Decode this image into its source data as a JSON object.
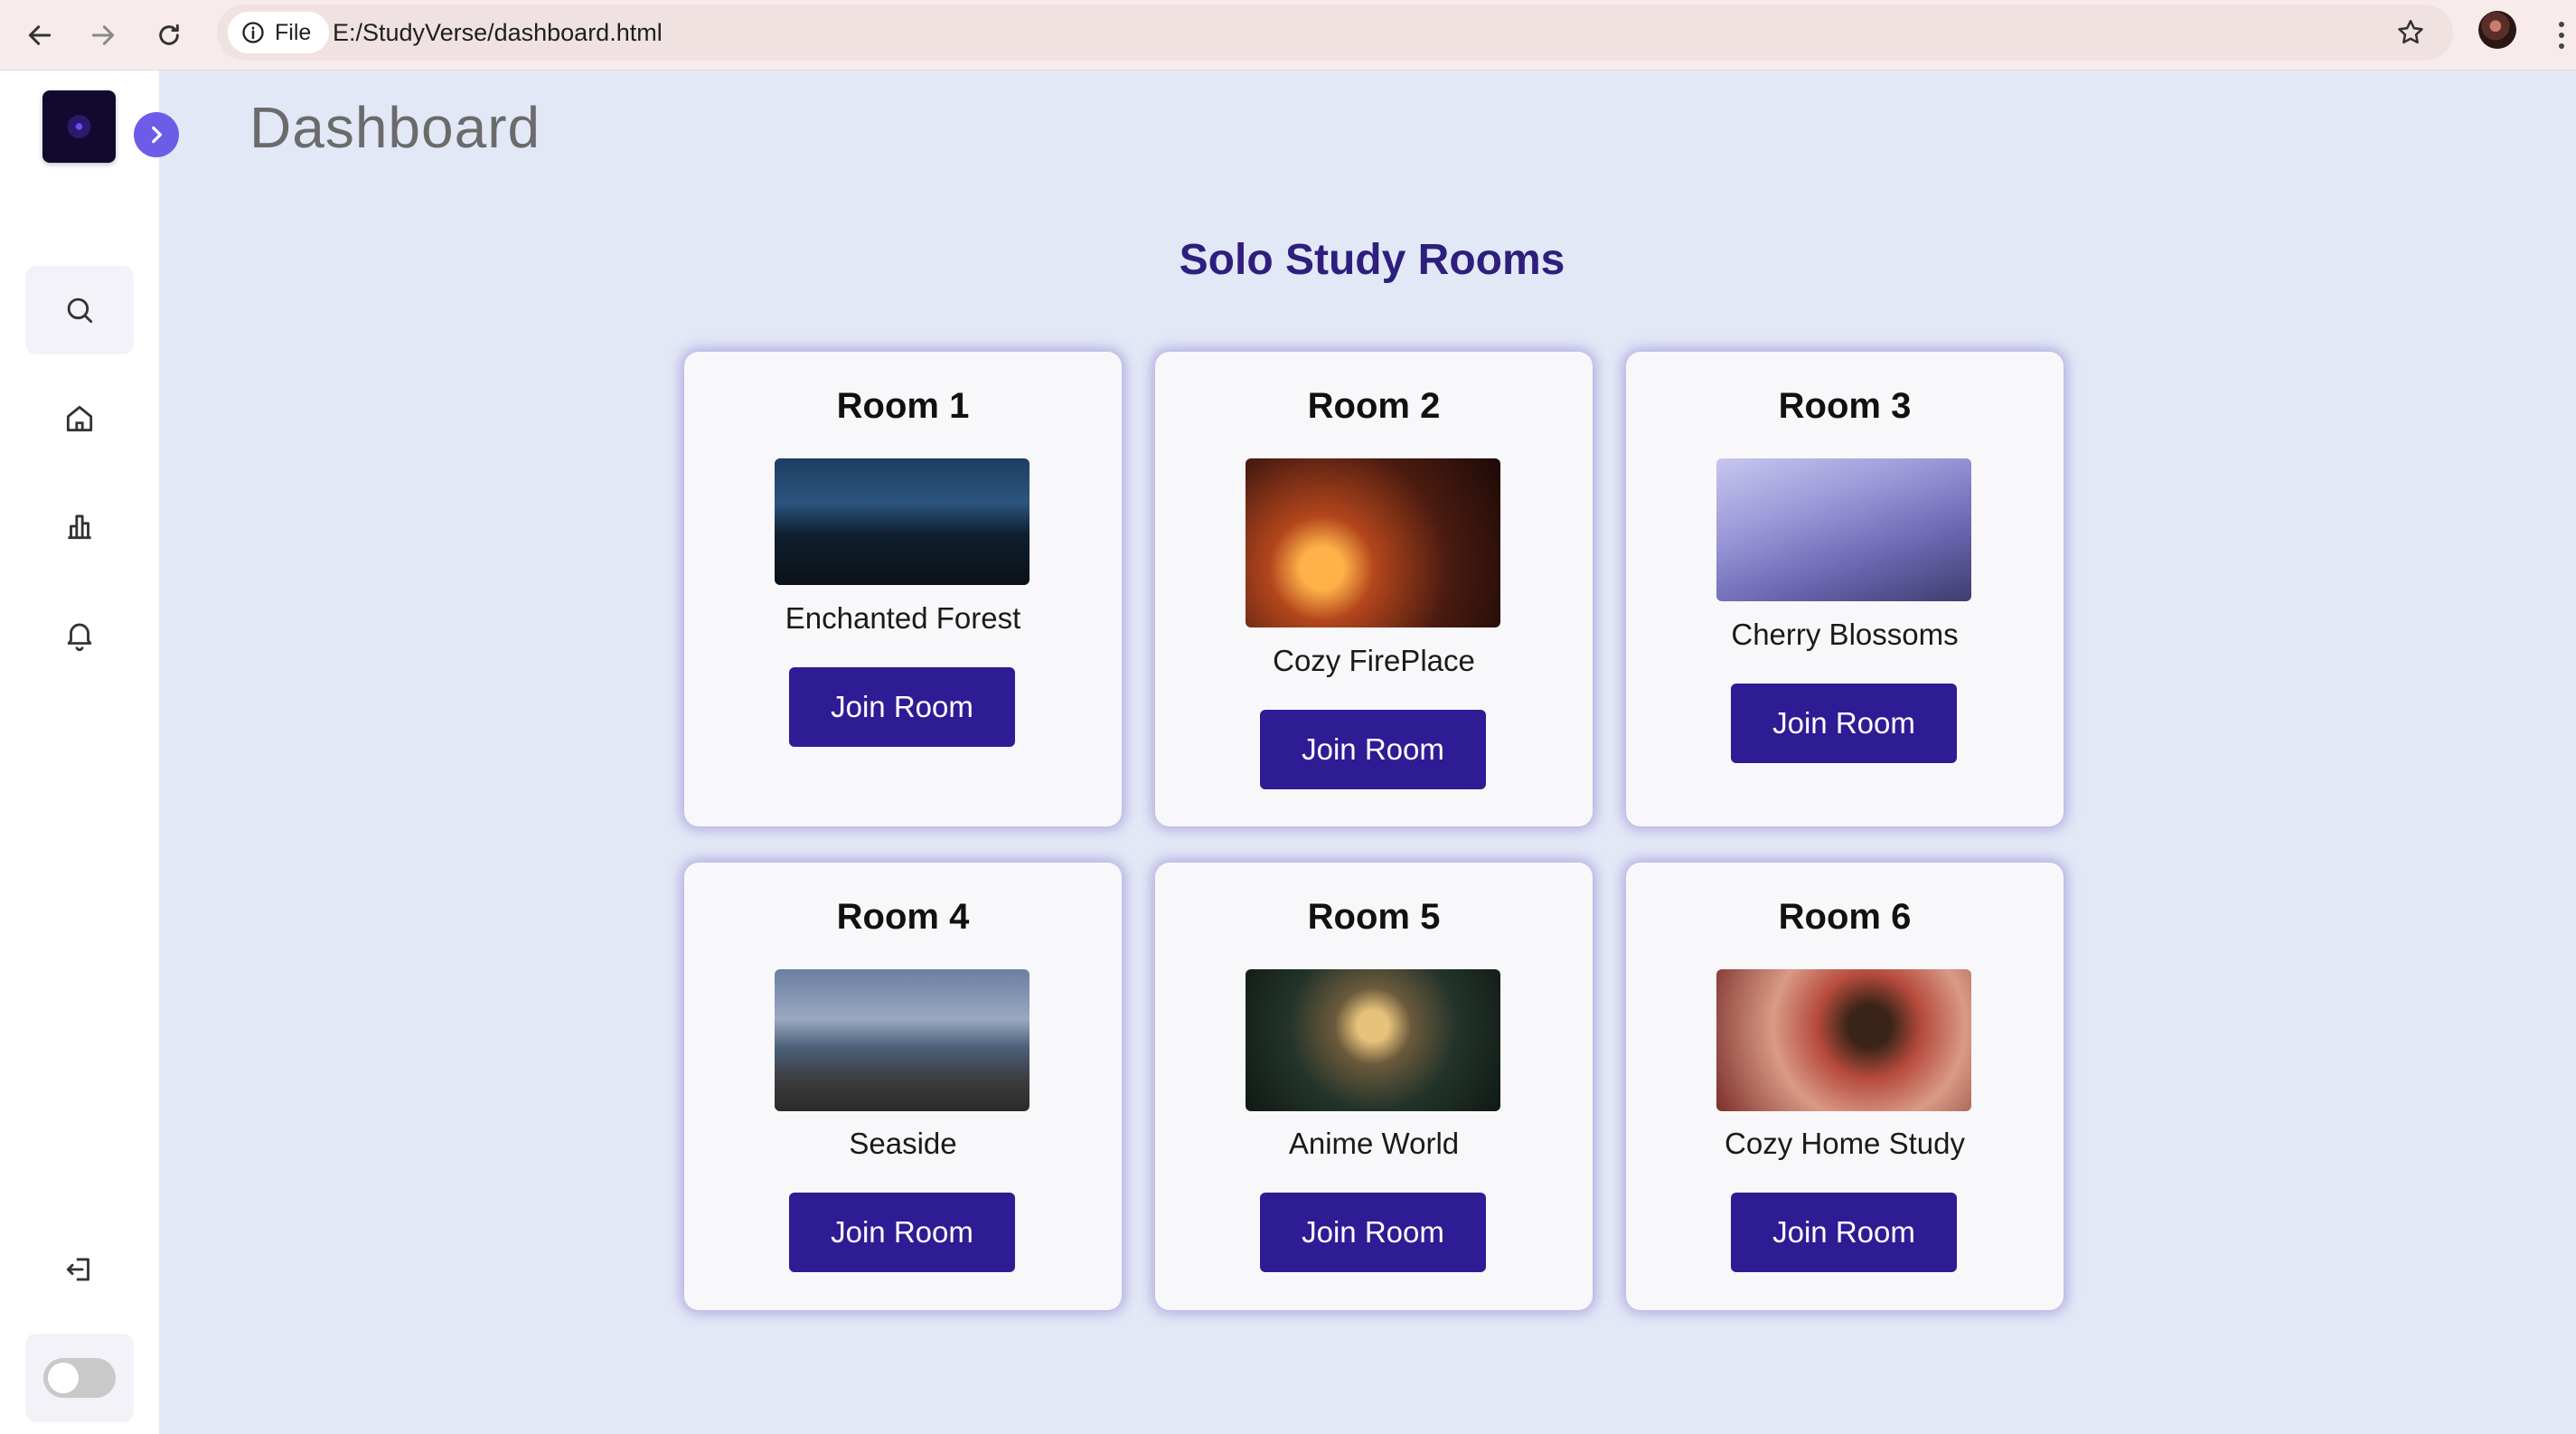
{
  "browser": {
    "file_label": "File",
    "url": "E:/StudyVerse/dashboard.html"
  },
  "sidebar": {
    "items": [
      {
        "icon": "search-icon"
      },
      {
        "icon": "home-icon"
      },
      {
        "icon": "bar-chart-icon"
      },
      {
        "icon": "bell-icon"
      },
      {
        "icon": "logout-icon"
      }
    ],
    "theme_toggle": "off"
  },
  "header": {
    "title": "Dashboard"
  },
  "main": {
    "section_title": "Solo Study Rooms",
    "rooms": [
      {
        "title": "Room 1",
        "name": "Enchanted Forest",
        "button": "Join Room"
      },
      {
        "title": "Room 2",
        "name": "Cozy FirePlace",
        "button": "Join Room"
      },
      {
        "title": "Room 3",
        "name": "Cherry Blossoms",
        "button": "Join Room"
      },
      {
        "title": "Room 4",
        "name": "Seaside",
        "button": "Join Room"
      },
      {
        "title": "Room 5",
        "name": "Anime World",
        "button": "Join Room"
      },
      {
        "title": "Room 6",
        "name": "Cozy Home Study",
        "button": "Join Room"
      }
    ]
  },
  "colors": {
    "accent": "#2e1c94",
    "background": "#e3e8f6",
    "section_title": "#2e1e7e"
  }
}
